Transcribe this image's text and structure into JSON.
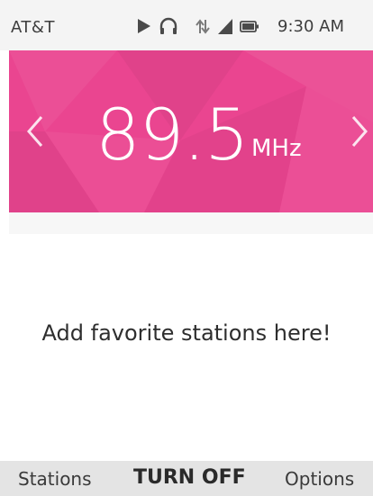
{
  "status_bar": {
    "carrier": "AT&T",
    "time": "9:30 AM",
    "icons": [
      "play-icon",
      "headphones-icon",
      "data-signal-icon",
      "cellular-signal-icon",
      "battery-icon"
    ]
  },
  "radio": {
    "frequency": "89.5",
    "unit": "MHz",
    "prev_icon": "chevron-left-icon",
    "next_icon": "chevron-right-icon",
    "accent_color": "#ea4590"
  },
  "favorites": {
    "empty_message": "Add favorite stations here!"
  },
  "softkeys": {
    "left": "Stations",
    "center": "TURN OFF",
    "right": "Options"
  }
}
